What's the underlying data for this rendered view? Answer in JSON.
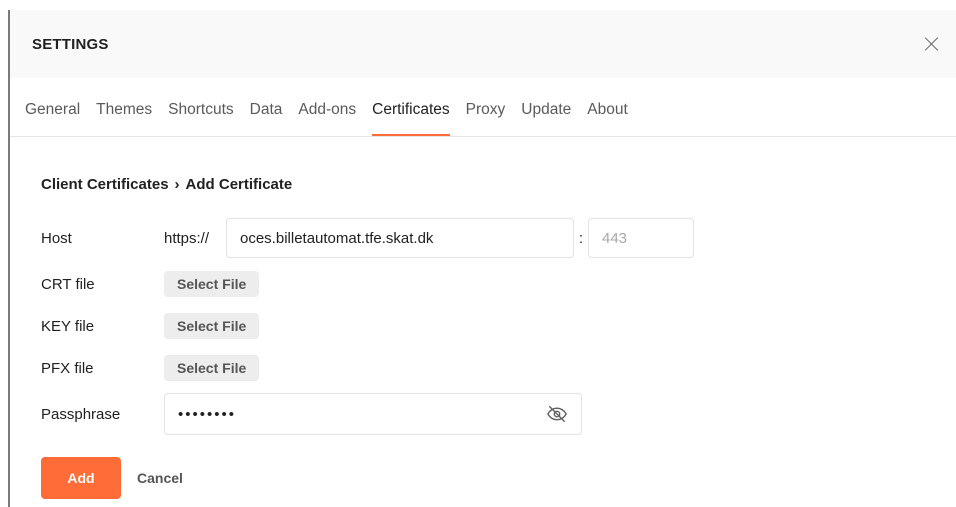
{
  "header": {
    "title": "SETTINGS"
  },
  "tabs": [
    {
      "label": "General"
    },
    {
      "label": "Themes"
    },
    {
      "label": "Shortcuts"
    },
    {
      "label": "Data"
    },
    {
      "label": "Add-ons"
    },
    {
      "label": "Certificates",
      "active": true
    },
    {
      "label": "Proxy"
    },
    {
      "label": "Update"
    },
    {
      "label": "About"
    }
  ],
  "breadcrumb": {
    "parent": "Client Certificates",
    "separator": "›",
    "current": "Add Certificate"
  },
  "form": {
    "host": {
      "label": "Host",
      "prefix": "https://",
      "value": "oces.billetautomat.tfe.skat.dk",
      "colon": ":",
      "port_placeholder": "443"
    },
    "crt": {
      "label": "CRT file",
      "button": "Select File"
    },
    "key": {
      "label": "KEY file",
      "button": "Select File"
    },
    "pfx": {
      "label": "PFX file",
      "button": "Select File"
    },
    "passphrase": {
      "label": "Passphrase",
      "masked_value": "••••••••",
      "icon": "eye-off-icon"
    }
  },
  "actions": {
    "add_label": "Add",
    "cancel_label": "Cancel"
  },
  "colors": {
    "accent": "#ff6c37",
    "header_bg": "#f9f9f9"
  }
}
